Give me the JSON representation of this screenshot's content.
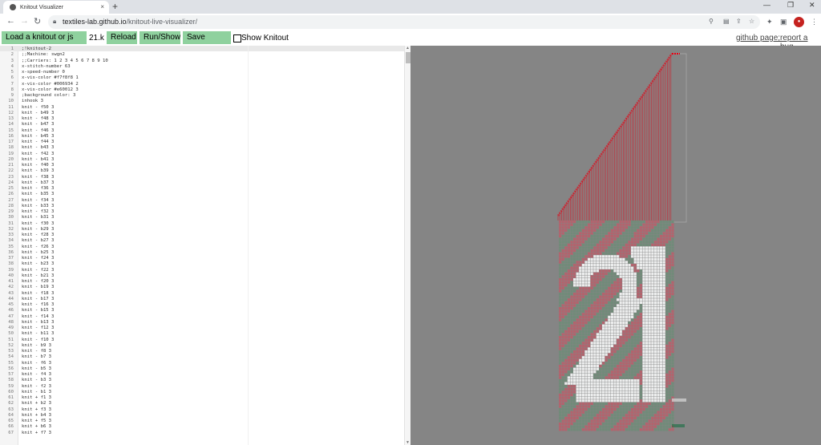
{
  "browser": {
    "tab_title": "Knitout Visualizer",
    "tab_close": "×",
    "new_tab": "+",
    "url_host": "textiles-lab.github.io",
    "url_path": "/knitout-live-visualizer/",
    "window_controls": [
      "—",
      "❐",
      "✕"
    ]
  },
  "toolbar": {
    "load_label": "Load a knitout or js file",
    "version": "21.k",
    "reload_label": "Reload",
    "run_label": "Run/Show",
    "save_label": "Save Knitout",
    "show_knitout_label": "Show Knitout",
    "github_label": "github page;",
    "bug_label": "report a bug"
  },
  "editor": {
    "lines": [
      ";!knitout-2",
      ";;Machine: swgn2",
      ";;Carriers: 1 2 3 4 5 6 7 8 9 10",
      "x-stitch-number 63",
      "x-speed-number 0",
      "x-vis-color #f7f8f8 1",
      "x-vis-color #006934 2",
      "x-vis-color #e60012 3",
      ";background color: 3",
      "inhook 3",
      "knit - f50 3",
      "knit - b49 3",
      "knit - f48 3",
      "knit - b47 3",
      "knit - f46 3",
      "knit - b45 3",
      "knit - f44 3",
      "knit - b43 3",
      "knit - f42 3",
      "knit - b41 3",
      "knit - f40 3",
      "knit - b39 3",
      "knit - f38 3",
      "knit - b37 3",
      "knit - f36 3",
      "knit - b35 3",
      "knit - f34 3",
      "knit - b33 3",
      "knit - f32 3",
      "knit - b31 3",
      "knit - f30 3",
      "knit - b29 3",
      "knit - f28 3",
      "knit - b27 3",
      "knit - f26 3",
      "knit - b25 3",
      "knit - f24 3",
      "knit - b23 3",
      "knit - f22 3",
      "knit - b21 3",
      "knit - f20 3",
      "knit - b19 3",
      "knit - f18 3",
      "knit - b17 3",
      "knit - f16 3",
      "knit - b15 3",
      "knit - f14 3",
      "knit - b13 3",
      "knit - f12 3",
      "knit - b11 3",
      "knit - f10 3",
      "knit - b9 3",
      "knit - f8 3",
      "knit - b7 3",
      "knit - f6 3",
      "knit - b5 3",
      "knit - f4 3",
      "knit - b3 3",
      "knit - f2 3",
      "knit - b1 3",
      "knit + f1 3",
      "knit + b2 3",
      "knit + f3 3",
      "knit + b4 3",
      "knit + f5 3",
      "knit + b6 3",
      "knit + f7 3"
    ]
  },
  "visualizer": {
    "background_color": "#858585",
    "yarn_colors": {
      "white": "#f7f8f8",
      "green": "#006934",
      "red": "#e60012"
    }
  }
}
